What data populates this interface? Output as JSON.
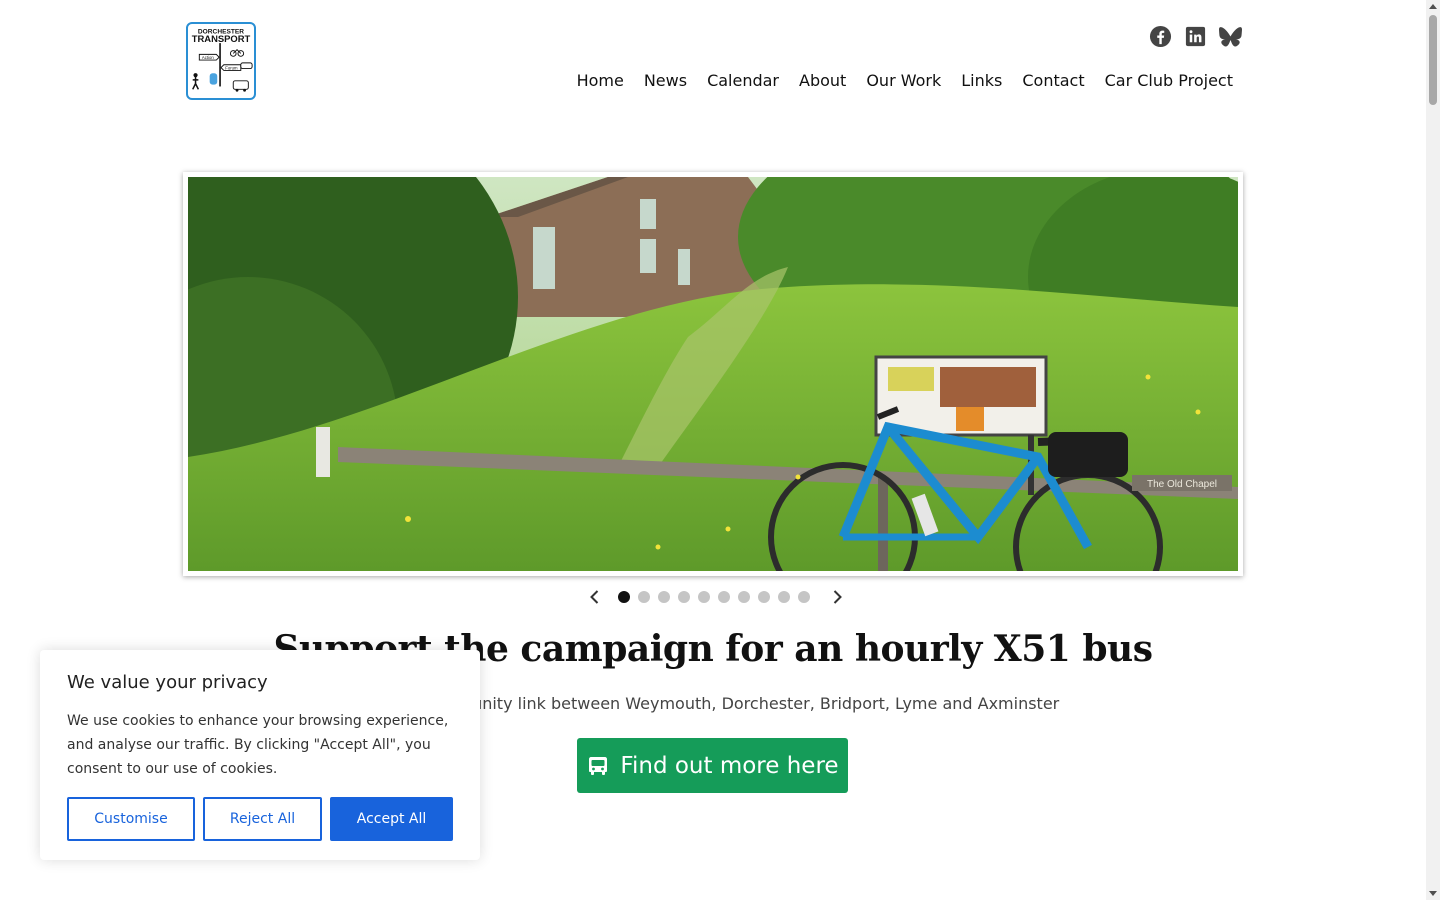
{
  "site": {
    "logo_text_top": "DORCHESTER",
    "logo_text_main": "TRANSPORT",
    "logo_sign_1": "Action",
    "logo_sign_2": "Forum"
  },
  "social": [
    {
      "icon": "facebook-icon"
    },
    {
      "icon": "linkedin-icon"
    },
    {
      "icon": "bluesky-icon"
    }
  ],
  "nav": {
    "items": [
      "Home",
      "News",
      "Calendar",
      "About",
      "Our Work",
      "Links",
      "Contact",
      "Car Club Project"
    ]
  },
  "slider": {
    "slide_count": 10,
    "active_index": 0,
    "sign_text": "The Old Chapel"
  },
  "campaign": {
    "headline": "Support the campaign for an hourly X51 bus",
    "subline": "A vital community link between Weymouth, Dorchester, Bridport, Lyme and Axminster",
    "cta_label": "Find out more here",
    "cta_icon": "bus-icon",
    "cta_color": "#159c59"
  },
  "cookie_banner": {
    "title": "We value your privacy",
    "message": "We use cookies to enhance your browsing experience, and analyse our traffic. By clicking \"Accept All\", you consent to our use of cookies.",
    "customise_label": "Customise",
    "reject_label": "Reject All",
    "accept_label": "Accept All",
    "accent_color": "#1863dc"
  }
}
